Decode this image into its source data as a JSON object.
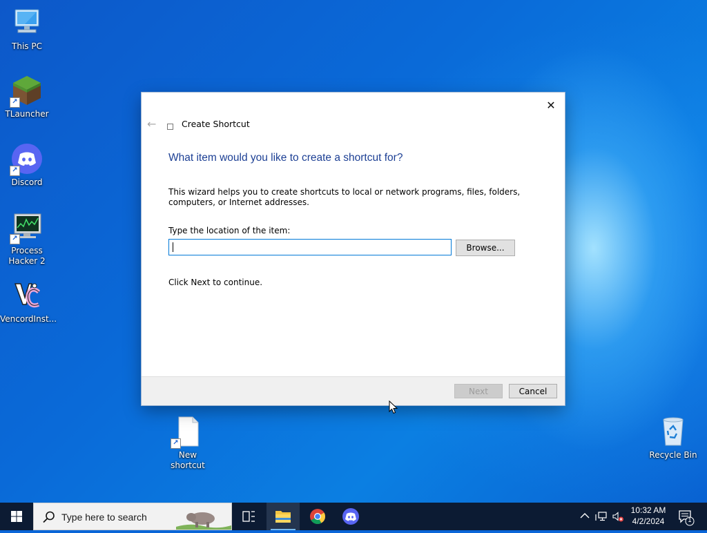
{
  "desktop": {
    "icons": [
      {
        "label": "This PC"
      },
      {
        "label": "TLauncher"
      },
      {
        "label": "Discord"
      },
      {
        "label": "Process Hacker 2"
      },
      {
        "label": "VencordInst..."
      },
      {
        "label": "New shortcut"
      },
      {
        "label": "Recycle Bin"
      }
    ]
  },
  "dialog": {
    "title": "Create Shortcut",
    "heading": "What item would you like to create a shortcut for?",
    "description": "This wizard helps you to create shortcuts to local or network programs, files, folders, computers, or Internet addresses.",
    "location_label": "Type the location of the item:",
    "location_value": "",
    "browse_label": "Browse...",
    "continue_text": "Click Next to continue.",
    "next_label": "Next",
    "cancel_label": "Cancel",
    "close_glyph": "✕",
    "back_glyph": "←"
  },
  "taskbar": {
    "search_placeholder": "Type here to search",
    "time": "10:32 AM",
    "date": "4/2/2024",
    "notification_count": "1",
    "pinned": [
      "task-view",
      "file-explorer",
      "chrome",
      "discord"
    ]
  },
  "colors": {
    "accent": "#0078d7",
    "heading": "#1c3f94",
    "taskbar": "#0c1b33"
  }
}
